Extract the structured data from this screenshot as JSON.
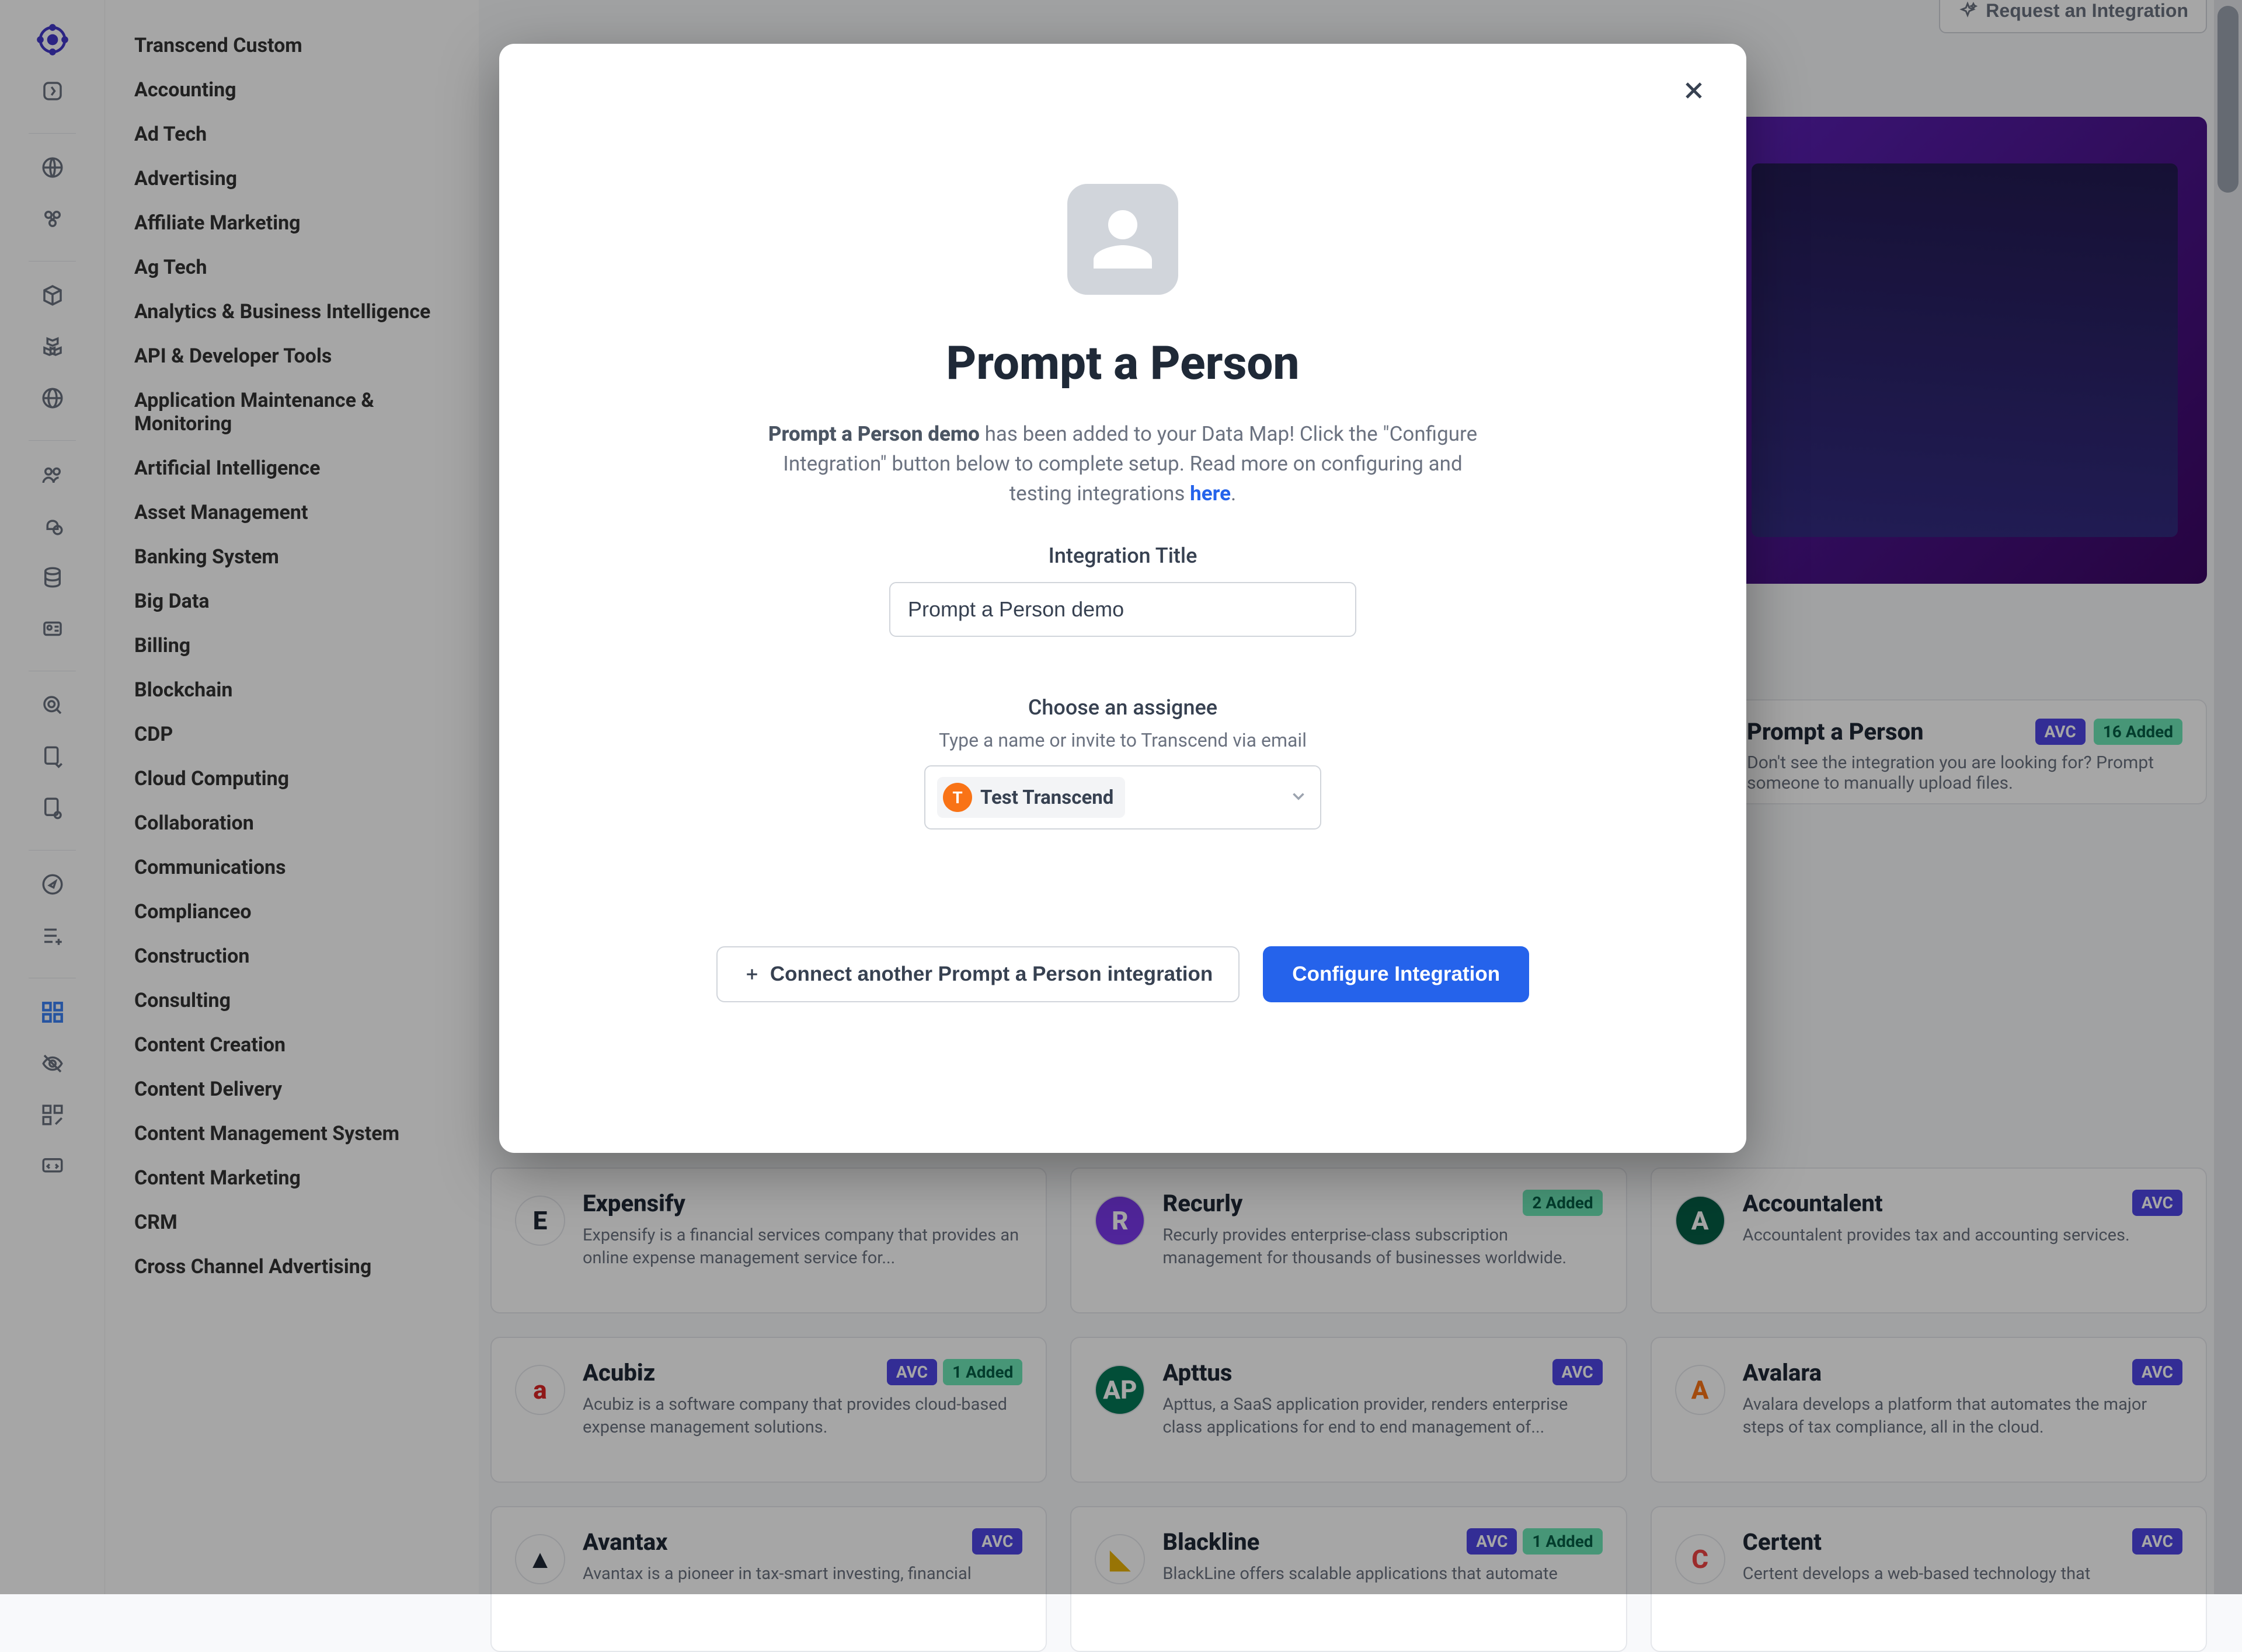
{
  "header": {
    "request_integration": "Request an Integration"
  },
  "categories": [
    "Transcend Custom",
    "Accounting",
    "Ad Tech",
    "Advertising",
    "Affiliate Marketing",
    "Ag Tech",
    "Analytics & Business Intelligence",
    "API & Developer Tools",
    "Application Maintenance & Monitoring",
    "Artificial Intelligence",
    "Asset Management",
    "Banking System",
    "Big Data",
    "Billing",
    "Blockchain",
    "CDP",
    "Cloud Computing",
    "Collaboration",
    "Communications",
    "Complianceo",
    "Construction",
    "Consulting",
    "Content Creation",
    "Content Delivery",
    "Content Management System",
    "Content Marketing",
    "CRM",
    "Cross Channel Advertising"
  ],
  "prompt_card": {
    "title": "Prompt a Person",
    "avc": "AVC",
    "added": "16 Added",
    "desc": "Don't see the integration you are looking for? Prompt someone to manually upload files."
  },
  "cards": [
    {
      "name": "Expensify",
      "desc": "Expensify is a financial services company that provides an online expense management service for...",
      "logo": "E",
      "logo_bg": "#fff",
      "logo_color": "#1f2937",
      "avc": "",
      "added": ""
    },
    {
      "name": "Recurly",
      "desc": "Recurly provides enterprise-class subscription management for thousands of businesses worldwide.",
      "logo": "R",
      "logo_bg": "#7c3aed",
      "logo_color": "#fff",
      "avc": "",
      "added": "2 Added"
    },
    {
      "name": "Accountalent",
      "desc": "Accountalent provides tax and accounting services.",
      "logo": "A",
      "logo_bg": "#065f46",
      "logo_color": "#fff",
      "avc": "AVC",
      "added": ""
    },
    {
      "name": "Acubiz",
      "desc": "Acubiz is a software company that provides cloud-based expense management solutions.",
      "logo": "a",
      "logo_bg": "#fff",
      "logo_color": "#dc2626",
      "avc": "AVC",
      "added": "1 Added"
    },
    {
      "name": "Apttus",
      "desc": "Apttus, a SaaS application provider, renders enterprise class applications for end to end management of...",
      "logo": "AP",
      "logo_bg": "#047857",
      "logo_color": "#fff",
      "avc": "AVC",
      "added": ""
    },
    {
      "name": "Avalara",
      "desc": "Avalara develops a platform that automates the major steps of tax compliance, all in the cloud.",
      "logo": "A",
      "logo_bg": "#fff",
      "logo_color": "#f97316",
      "avc": "AVC",
      "added": ""
    },
    {
      "name": "Avantax",
      "desc": "Avantax is a pioneer in tax-smart investing, financial",
      "logo": "▲",
      "logo_bg": "#fff",
      "logo_color": "#1f2937",
      "avc": "AVC",
      "added": ""
    },
    {
      "name": "Blackline",
      "desc": "BlackLine offers scalable applications that automate",
      "logo": "◣",
      "logo_bg": "#fff",
      "logo_color": "#eab308",
      "avc": "AVC",
      "added": "1 Added"
    },
    {
      "name": "Certent",
      "desc": "Certent develops a web-based technology that",
      "logo": "C",
      "logo_bg": "#fff",
      "logo_color": "#ef4444",
      "avc": "AVC",
      "added": ""
    }
  ],
  "modal": {
    "title": "Prompt a Person",
    "blurb_bold": "Prompt a Person demo",
    "blurb_rest1": " has been added to your Data Map! Click the \"Configure Integration\" button below to complete setup. Read more on configuring and testing integrations ",
    "blurb_link": "here",
    "integration_title_label": "Integration Title",
    "integration_title_value": "Prompt a Person demo",
    "choose_assignee_label": "Choose an assignee",
    "choose_assignee_sub": "Type a name or invite to Transcend via email",
    "assignee_initial": "T",
    "assignee_name": "Test Transcend",
    "connect_another": "Connect another Prompt a Person integration",
    "configure": "Configure Integration"
  }
}
